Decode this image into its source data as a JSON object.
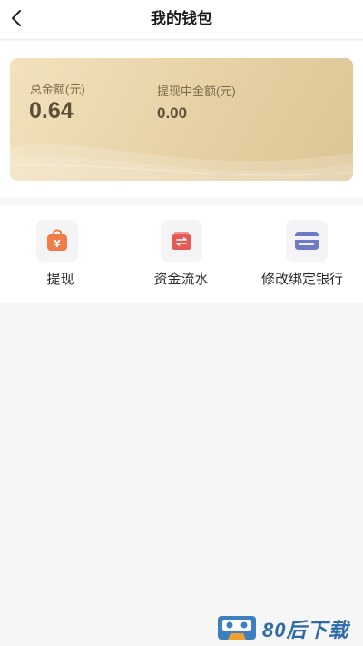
{
  "header": {
    "title": "我的钱包",
    "back_icon": "chevron-left-icon"
  },
  "wallet": {
    "total_label": "总金额(元)",
    "total_value": "0.64",
    "withdrawing_label": "提现中金额(元)",
    "withdrawing_value": "0.00"
  },
  "menu": {
    "items": [
      {
        "label": "提现",
        "icon": "yuan-bag-icon",
        "color": "#ef7d48"
      },
      {
        "label": "资金流水",
        "icon": "transfer-icon",
        "color": "#e55a55"
      },
      {
        "label": "修改绑定银行",
        "icon": "bank-card-icon",
        "color": "#6e7bc4"
      }
    ]
  },
  "watermark": {
    "text": "80后下载",
    "color": "#2c6aa8"
  }
}
